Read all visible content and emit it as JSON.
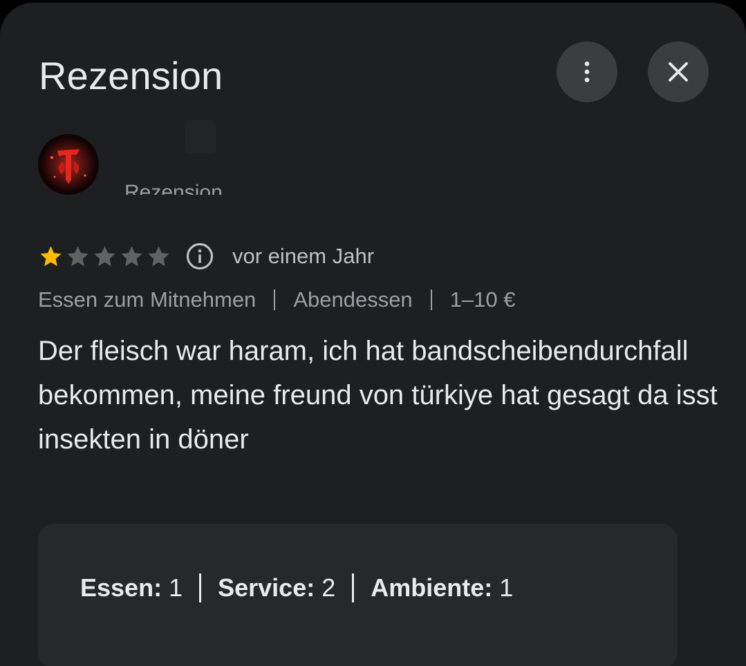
{
  "header": {
    "title": "Rezension",
    "more_icon": "more-vert-icon",
    "close_icon": "close-icon"
  },
  "reviewer": {
    "avatar_icon": "red-glyph-avatar",
    "subtitle_cut": "Rezension"
  },
  "review": {
    "rating": 1,
    "max_rating": 5,
    "star_filled_color": "#fbbc04",
    "star_empty_color": "#5f6368",
    "date": "vor einem Jahr",
    "meta": [
      "Essen zum Mitnehmen",
      "Abendessen",
      "1–10 €"
    ],
    "text": "Der fleisch war haram, ich hat bandscheibendurchfall bekommen, meine freund von türkiye hat gesagt da isst insekten in döner"
  },
  "sub_ratings": [
    {
      "label": "Essen:",
      "value": "1"
    },
    {
      "label": "Service:",
      "value": "2"
    },
    {
      "label": "Ambiente:",
      "value": "1"
    }
  ]
}
